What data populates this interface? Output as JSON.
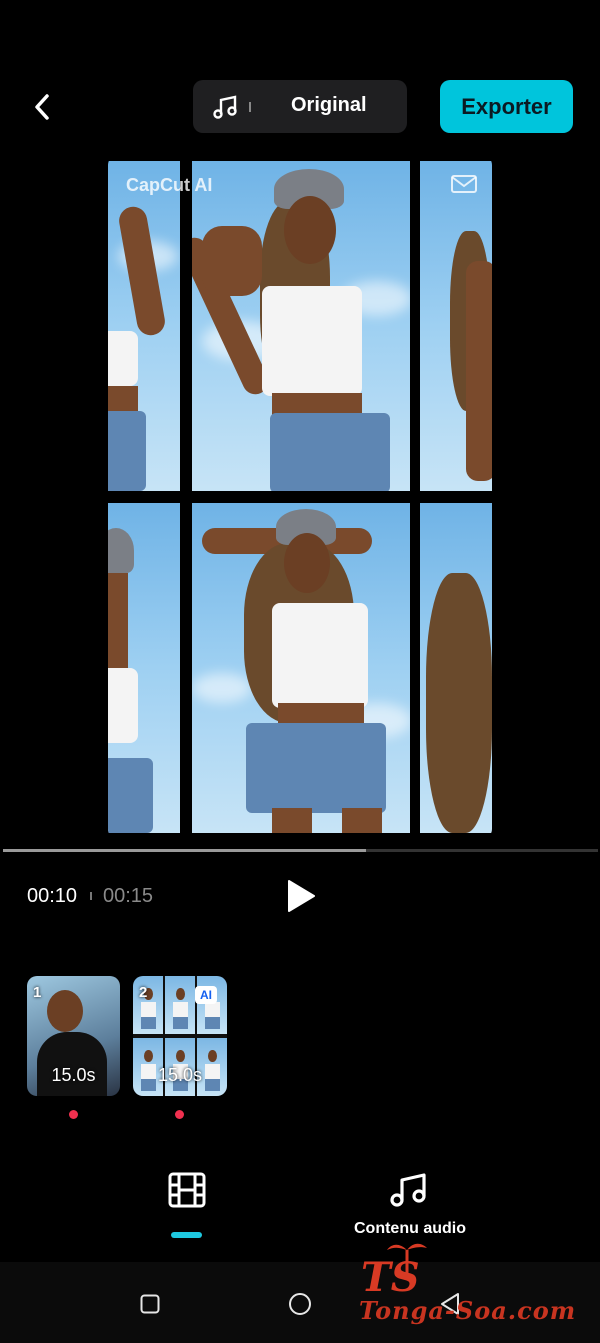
{
  "header": {
    "audio_label": "Original",
    "export_label": "Exporter"
  },
  "preview": {
    "watermark": "CapCut AI"
  },
  "playback": {
    "current_time": "00:10",
    "total_time": "00:15",
    "progress": 0.61
  },
  "clips": [
    {
      "index": "1",
      "duration": "15.0s"
    },
    {
      "index": "2",
      "duration": "15.0s",
      "badge": "AI"
    }
  ],
  "bottom_tabs": {
    "audio_label": "Contenu audio"
  },
  "branding": {
    "logo_text": "TS",
    "site_text": "Tonga-Soa.com"
  },
  "colors": {
    "accent": "#00c5dc",
    "marker": "#f0304f"
  }
}
